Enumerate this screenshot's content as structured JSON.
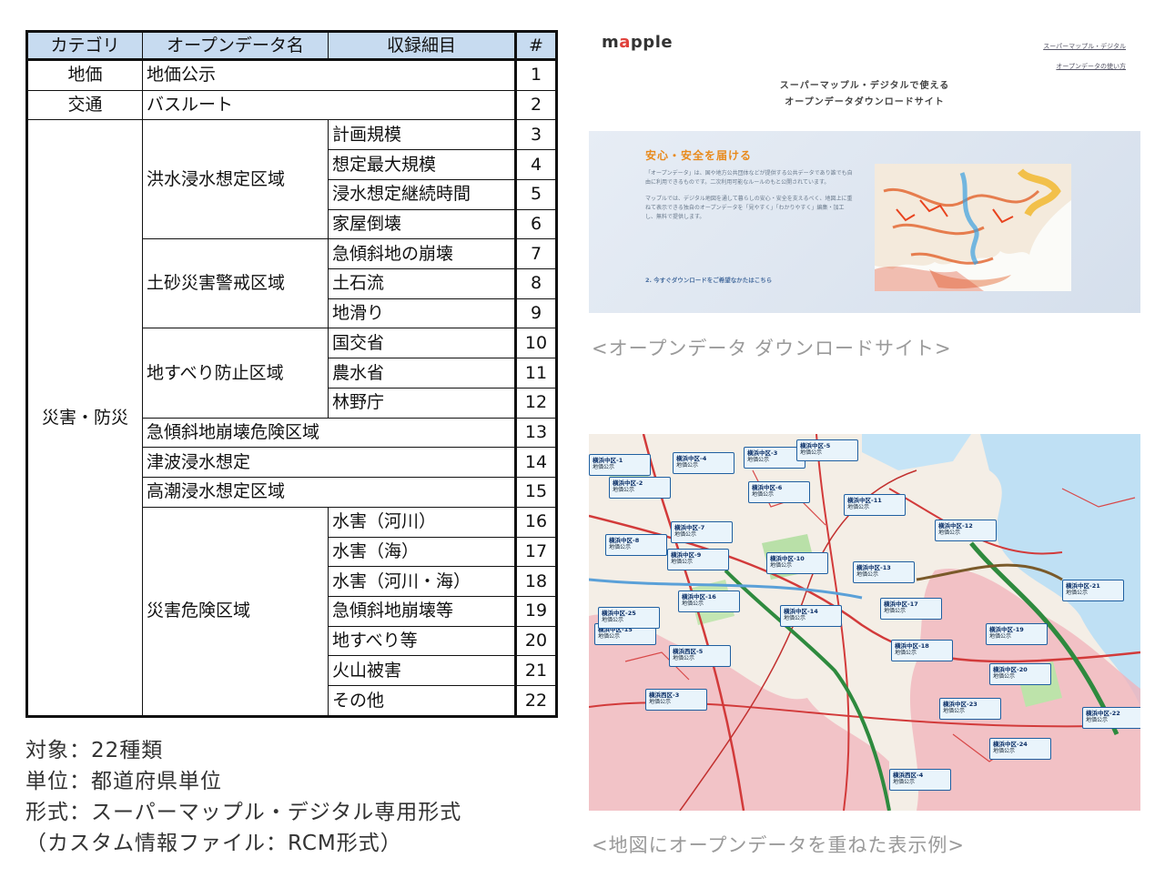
{
  "table": {
    "headers": [
      "カテゴリ",
      "オープンデータ名",
      "収録細目",
      "#"
    ],
    "rows": [
      {
        "category": "地価",
        "name": "地価公示",
        "detail": "",
        "num": "1"
      },
      {
        "category": "交通",
        "name": "バスルート",
        "detail": "",
        "num": "2"
      },
      {
        "category": "災害・防災",
        "name": "洪水浸水想定区域",
        "detail": "計画規模",
        "num": "3"
      },
      {
        "category": "",
        "name": "",
        "detail": "想定最大規模",
        "num": "4"
      },
      {
        "category": "",
        "name": "",
        "detail": "浸水想定継続時間",
        "num": "5"
      },
      {
        "category": "",
        "name": "",
        "detail": "家屋倒壊",
        "num": "6"
      },
      {
        "category": "",
        "name": "土砂災害警戒区域",
        "detail": "急傾斜地の崩壊",
        "num": "7"
      },
      {
        "category": "",
        "name": "",
        "detail": "土石流",
        "num": "8"
      },
      {
        "category": "",
        "name": "",
        "detail": "地滑り",
        "num": "9"
      },
      {
        "category": "",
        "name": "地すべり防止区域",
        "detail": "国交省",
        "num": "10"
      },
      {
        "category": "",
        "name": "",
        "detail": "農水省",
        "num": "11"
      },
      {
        "category": "",
        "name": "",
        "detail": "林野庁",
        "num": "12"
      },
      {
        "category": "",
        "name": "急傾斜地崩壊危険区域",
        "detail": "",
        "num": "13"
      },
      {
        "category": "",
        "name": "津波浸水想定",
        "detail": "",
        "num": "14"
      },
      {
        "category": "",
        "name": "高潮浸水想定区域",
        "detail": "",
        "num": "15"
      },
      {
        "category": "",
        "name": "災害危険区域",
        "detail": "水害（河川）",
        "num": "16"
      },
      {
        "category": "",
        "name": "",
        "detail": "水害（海）",
        "num": "17"
      },
      {
        "category": "",
        "name": "",
        "detail": "水害（河川・海）",
        "num": "18"
      },
      {
        "category": "",
        "name": "",
        "detail": "急傾斜地崩壊等",
        "num": "19"
      },
      {
        "category": "",
        "name": "",
        "detail": "地すべり等",
        "num": "20"
      },
      {
        "category": "",
        "name": "",
        "detail": "火山被害",
        "num": "21"
      },
      {
        "category": "",
        "name": "",
        "detail": "その他",
        "num": "22"
      }
    ]
  },
  "notes": {
    "target": "対象：22種類",
    "unit": "単位：都道府県単位",
    "format": "形式：スーパーマップル・デジタル専用形式",
    "format_detail": "（カスタム情報ファイル：RCM形式）"
  },
  "site_screenshot": {
    "logo": "mapple",
    "header_links": [
      "スーパーマップル・デジタル",
      "オープンデータの使い方"
    ],
    "heading_line1": "スーパーマップル・デジタルで使える",
    "heading_line2": "オープンデータダウンロードサイト",
    "hero_title": "安心・安全を届ける",
    "hero_paragraph1": "「オープンデータ」は、国や地方公共団体などが提供する公共データであり誰でも自由に利用できるものです。二次利用可能なルールのもと公開されています。",
    "hero_paragraph2": "マップルでは、デジタル地図を通して暮らしの安心・安全を支えるべく、地図上に重ねて表示できる独自のオープンデータを「見やすく」「わかりやすく」編集・加工し、無料で提供します。",
    "hero_link": "2. 今すぐダウンロードをご希望なかたはこちら"
  },
  "caption_site": "<オープンデータ ダウンロードサイト>",
  "caption_map": "<地図にオープンデータを重ねた表示例>",
  "map_labels": [
    {
      "title": "横浜中区-1",
      "sub": "地価公示"
    },
    {
      "title": "横浜中区-2",
      "sub": "地価公示"
    },
    {
      "title": "横浜中区-3",
      "sub": "地価公示"
    },
    {
      "title": "横浜中区-4",
      "sub": "地価公示"
    },
    {
      "title": "横浜中区-5",
      "sub": "地価公示"
    },
    {
      "title": "横浜中区-6",
      "sub": "地価公示"
    },
    {
      "title": "横浜中区-7",
      "sub": "地価公示"
    },
    {
      "title": "横浜中区-8",
      "sub": "地価公示"
    },
    {
      "title": "横浜中区-9",
      "sub": "地価公示"
    },
    {
      "title": "横浜中区-10",
      "sub": "地価公示"
    },
    {
      "title": "横浜中区-11",
      "sub": "地価公示"
    },
    {
      "title": "横浜中区-12",
      "sub": "地価公示"
    },
    {
      "title": "横浜中区-13",
      "sub": "地価公示"
    },
    {
      "title": "横浜中区-14",
      "sub": "地価公示"
    },
    {
      "title": "横浜中区-15",
      "sub": "地価公示"
    },
    {
      "title": "横浜中区-16",
      "sub": "地価公示"
    },
    {
      "title": "横浜中区-17",
      "sub": "地価公示"
    },
    {
      "title": "横浜中区-18",
      "sub": "地価公示"
    },
    {
      "title": "横浜中区-19",
      "sub": "地価公示"
    },
    {
      "title": "横浜中区-20",
      "sub": "地価公示"
    },
    {
      "title": "横浜中区-21",
      "sub": "地価公示"
    },
    {
      "title": "横浜中区-22",
      "sub": "地価公示"
    },
    {
      "title": "横浜中区-23",
      "sub": "地価公示"
    },
    {
      "title": "横浜中区-24",
      "sub": "地価公示"
    },
    {
      "title": "横浜中区-25",
      "sub": "地価公示"
    },
    {
      "title": "横浜西区-3",
      "sub": "地価公示"
    },
    {
      "title": "横浜西区-4",
      "sub": "地価公示"
    },
    {
      "title": "横浜西区-5",
      "sub": "地価公示"
    }
  ]
}
